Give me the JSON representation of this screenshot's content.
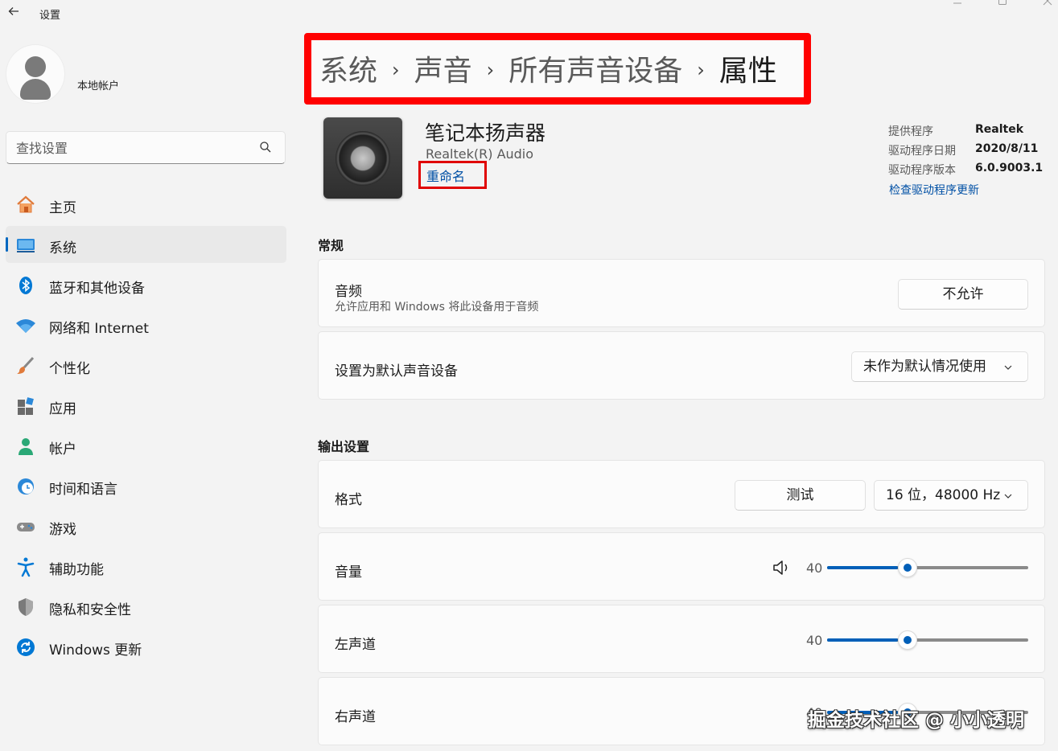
{
  "window": {
    "title": "设置"
  },
  "user": {
    "name": "",
    "type": "本地帐户"
  },
  "search": {
    "placeholder": "查找设置"
  },
  "sidebar": {
    "items": [
      {
        "label": "主页",
        "icon": "home-icon"
      },
      {
        "label": "系统",
        "icon": "system-icon",
        "active": true
      },
      {
        "label": "蓝牙和其他设备",
        "icon": "bluetooth-icon"
      },
      {
        "label": "网络和 Internet",
        "icon": "wifi-icon"
      },
      {
        "label": "个性化",
        "icon": "brush-icon"
      },
      {
        "label": "应用",
        "icon": "apps-icon"
      },
      {
        "label": "帐户",
        "icon": "account-icon"
      },
      {
        "label": "时间和语言",
        "icon": "clock-globe-icon"
      },
      {
        "label": "游戏",
        "icon": "gamepad-icon"
      },
      {
        "label": "辅助功能",
        "icon": "accessibility-icon"
      },
      {
        "label": "隐私和安全性",
        "icon": "shield-icon"
      },
      {
        "label": "Windows 更新",
        "icon": "update-icon"
      }
    ]
  },
  "breadcrumb": {
    "items": [
      "系统",
      "声音",
      "所有声音设备"
    ],
    "current": "属性",
    "separator": "›"
  },
  "device": {
    "name": "笔记本扬声器",
    "subtitle": "Realtek(R) Audio",
    "rename_label": "重命名",
    "driver": {
      "provider_label": "提供程序",
      "provider_value": "Realtek",
      "date_label": "驱动程序日期",
      "date_value": "2020/8/11",
      "version_label": "驱动程序版本",
      "version_value": "6.0.9003.1",
      "update_link": "检查驱动程序更新"
    }
  },
  "general": {
    "title": "常规",
    "audio": {
      "title": "音频",
      "description": "允许应用和 Windows 将此设备用于音频",
      "button": "不允许"
    },
    "default_device": {
      "title": "设置为默认声音设备",
      "selected": "未作为默认情况使用"
    }
  },
  "output": {
    "title": "输出设置",
    "format": {
      "title": "格式",
      "test_button": "测试",
      "selected": "16 位，48000 Hz"
    },
    "volume": {
      "title": "音量",
      "value": 40
    },
    "left": {
      "title": "左声道",
      "value": 40
    },
    "right": {
      "title": "右声道",
      "value": 40
    }
  },
  "watermark": "掘金技术社区 @ 小小透明",
  "colors": {
    "accent": "#005fb8",
    "highlight_frame": "#ff0000",
    "link": "#0050a5"
  }
}
